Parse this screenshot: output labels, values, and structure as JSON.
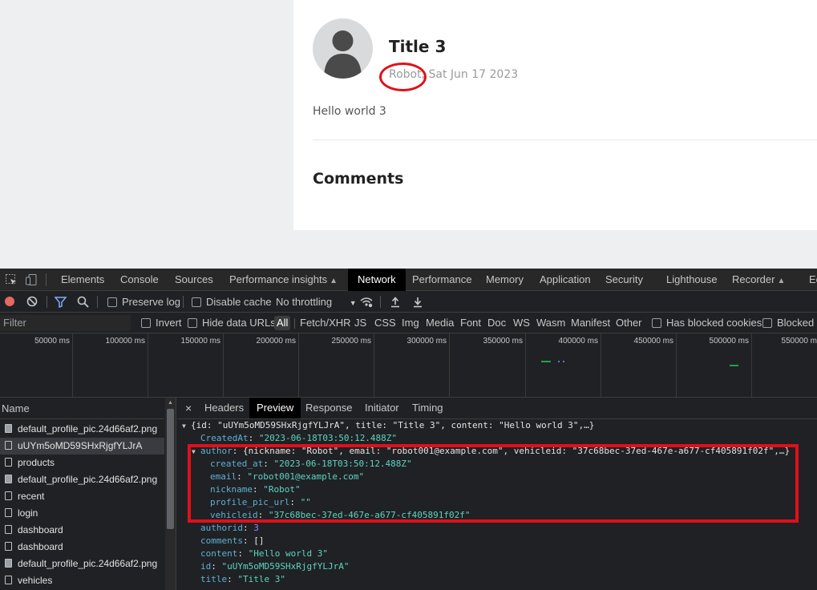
{
  "page": {
    "post_title": "Title 3",
    "post_meta": "Robot, Sat Jun 17 2023",
    "post_content": "Hello world 3",
    "comments_heading": "Comments"
  },
  "devtools": {
    "tabs": [
      "Elements",
      "Console",
      "Sources",
      "Performance insights",
      "Network",
      "Performance",
      "Memory",
      "Application",
      "Security",
      "Lighthouse",
      "Recorder",
      "Ec"
    ],
    "active_tab": "Network",
    "toolbar": {
      "preserve_log": "Preserve log",
      "disable_cache": "Disable cache",
      "throttling": "No throttling"
    },
    "filter": {
      "placeholder": "Filter",
      "invert": "Invert",
      "hide_data_urls": "Hide data URLs",
      "types": [
        "All",
        "Fetch/XHR",
        "JS",
        "CSS",
        "Img",
        "Media",
        "Font",
        "Doc",
        "WS",
        "Wasm",
        "Manifest",
        "Other"
      ],
      "has_blocked_cookies": "Has blocked cookies",
      "blocked_requests": "Blocked R"
    },
    "timeline_ticks": [
      "50000 ms",
      "100000 ms",
      "150000 ms",
      "200000 ms",
      "250000 ms",
      "300000 ms",
      "350000 ms",
      "400000 ms",
      "450000 ms",
      "500000 ms",
      "550000 m"
    ],
    "requests_header": "Name",
    "requests": [
      {
        "name": "default_profile_pic.24d66af2.png",
        "type": "img"
      },
      {
        "name": "uUYm5oMD59SHxRjgfYLJrA",
        "type": "doc"
      },
      {
        "name": "products",
        "type": "doc"
      },
      {
        "name": "default_profile_pic.24d66af2.png",
        "type": "img"
      },
      {
        "name": "recent",
        "type": "doc"
      },
      {
        "name": "login",
        "type": "doc"
      },
      {
        "name": "dashboard",
        "type": "doc"
      },
      {
        "name": "dashboard",
        "type": "doc"
      },
      {
        "name": "default_profile_pic.24d66af2.png",
        "type": "img"
      },
      {
        "name": "vehicles",
        "type": "doc"
      }
    ],
    "detail_close": "×",
    "detail_tabs": [
      "Headers",
      "Preview",
      "Response",
      "Initiator",
      "Timing"
    ],
    "active_detail_tab": "Preview",
    "preview": {
      "root_summary": "{id: \"uUYm5oMD59SHxRjgfYLJrA\", title: \"Title 3\", content: \"Hello world 3\",…}",
      "createdAt_key": "CreatedAt",
      "createdAt_val": "\"2023-06-18T03:50:12.488Z\"",
      "author_key": "author",
      "author_summary": "{nickname: \"Robot\", email: \"robot001@example.com\", vehicleid: \"37c68bec-37ed-467e-a677-cf405891f02f\",…}",
      "created_at_key": "created_at",
      "created_at_val": "\"2023-06-18T03:50:12.488Z\"",
      "email_key": "email",
      "email_val": "\"robot001@example.com\"",
      "nickname_key": "nickname",
      "nickname_val": "\"Robot\"",
      "profile_pic_key": "profile_pic_url",
      "profile_pic_val": "\"\"",
      "vehicleid_key": "vehicleid",
      "vehicleid_val": "\"37c68bec-37ed-467e-a677-cf405891f02f\"",
      "authorid_key": "authorid",
      "authorid_val": "3",
      "comments_key": "comments",
      "comments_val": "[]",
      "content_key": "content",
      "content_val": "\"Hello world 3\"",
      "id_key": "id",
      "id_val": "\"uUYm5oMD59SHxRjgfYLJrA\"",
      "title_key": "title",
      "title_val": "\"Title 3\""
    }
  },
  "colors": {
    "annotation_red": "#e0101a",
    "devtools_bg": "#202124",
    "json_key": "#5db0d7",
    "json_string": "#5cd5c4",
    "json_number": "#9980ff"
  }
}
